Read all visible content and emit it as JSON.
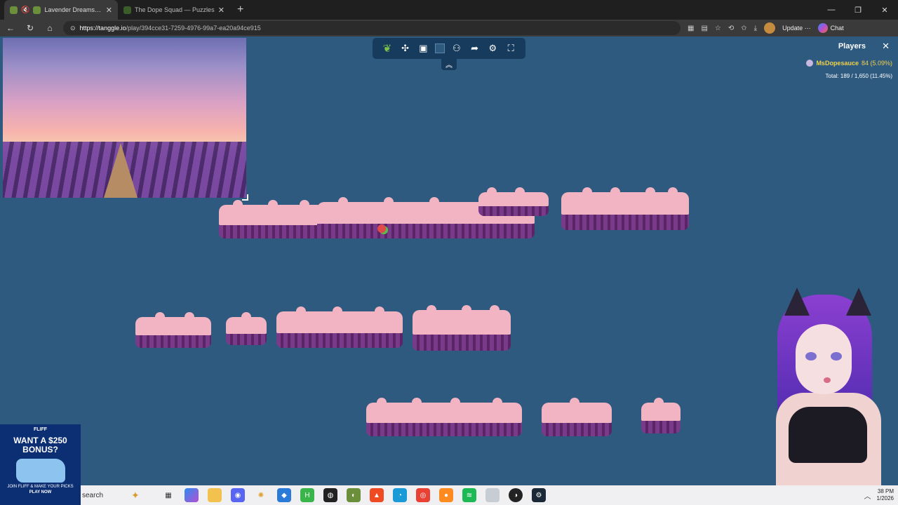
{
  "browser": {
    "tabs": [
      {
        "title": "Lavender Dreams | Sky Jig",
        "active": true
      },
      {
        "title": "The Dope Squad — Puzzles",
        "active": false
      }
    ],
    "url_host": "https://tanggle.io",
    "url_path": "/play/394cce31-7259-4976-99a7-ea20a94ce915",
    "update_label": "Update",
    "chat_label": "Chat"
  },
  "puzzle": {
    "players_title": "Players",
    "player": {
      "name": "MsDopesauce",
      "score": "84 (5.09%)"
    },
    "total": "Total: 189 / 1,650 (11.45%)"
  },
  "ad": {
    "brand": "FLIFF",
    "headline": "WANT A $250 BONUS?",
    "subline": "JOIN FLIFF & MAKE YOUR PICKS",
    "cta": "PLAY NOW"
  },
  "taskbar": {
    "search_placeholder": "search",
    "clock_time": "38 PM",
    "clock_date": "1/2026"
  },
  "colors": {
    "canvas_bg": "#2e5a80",
    "toolbar_bg": "#173b5c",
    "player_name": "#f1d24a",
    "piece_sky": "#f2b4c2",
    "piece_lavender": "#7a3a8a"
  },
  "icons": [
    "tanggle-logo-icon",
    "puzzle-piece-icon",
    "image-preview-icon",
    "background-color-icon",
    "players-icon",
    "share-icon",
    "settings-icon",
    "fullscreen-icon",
    "collapse-chevron-icon",
    "close-icon"
  ]
}
